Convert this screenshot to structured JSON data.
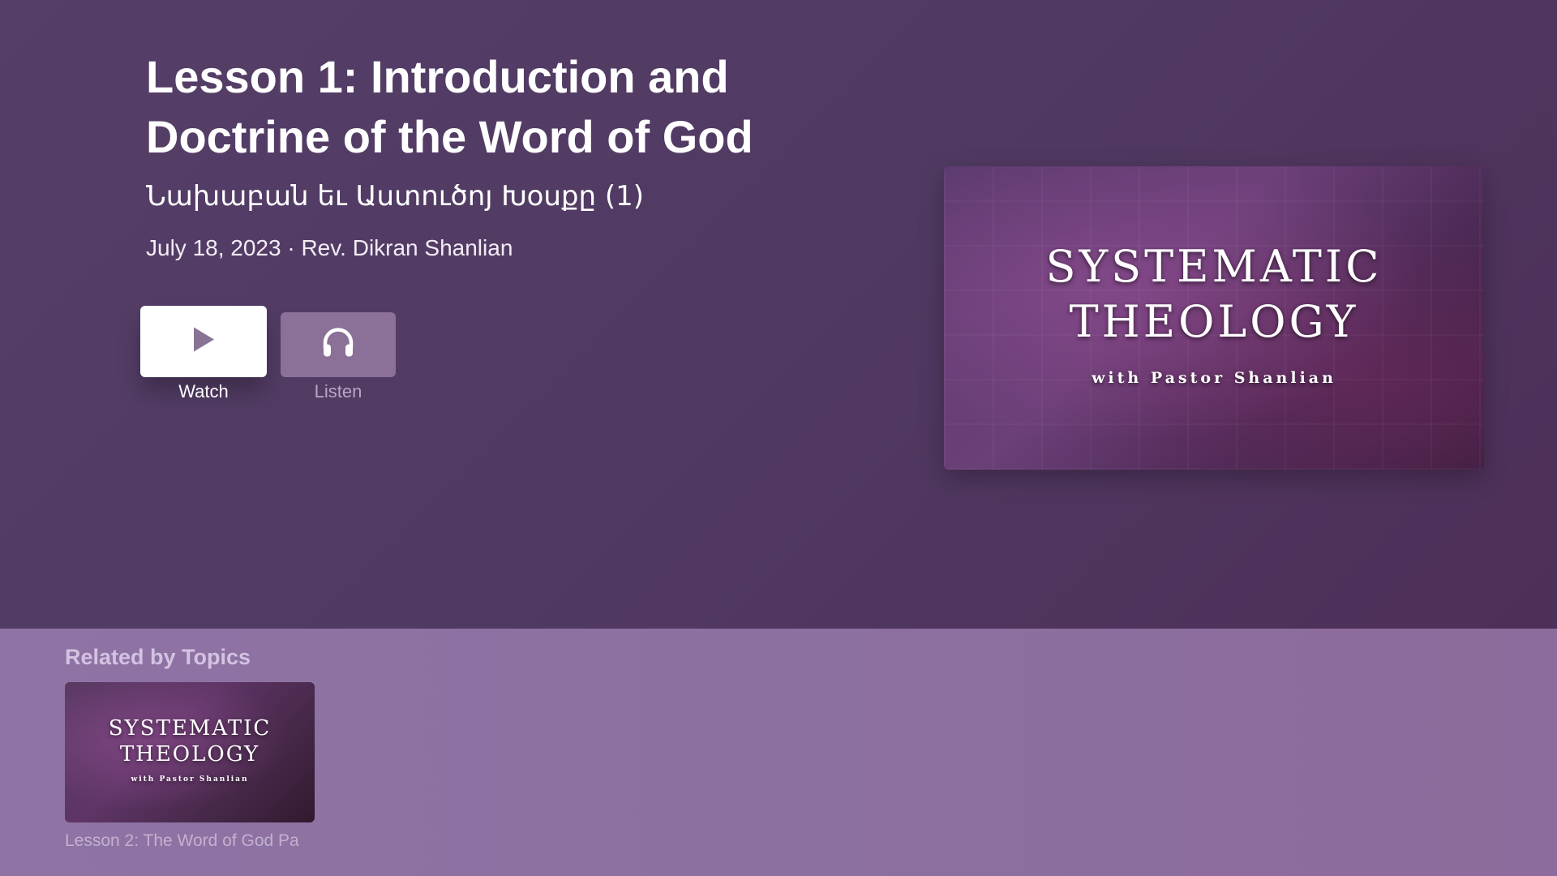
{
  "episode": {
    "title": "Lesson 1: Introduction and Doctrine of the Word of God",
    "subtitle": "Նախաբան եւ Աստուծոյ Խօսքը (1)",
    "meta": "July 18, 2023 · Rev. Dikran Shanlian"
  },
  "actions": {
    "watch": {
      "label": "Watch",
      "icon": "play-icon"
    },
    "listen": {
      "label": "Listen",
      "icon": "headphones-icon"
    }
  },
  "poster": {
    "line1": "SYSTEMATIC",
    "line2": "THEOLOGY",
    "line3": "with Pastor Shanlian"
  },
  "related": {
    "heading": "Related by Topics",
    "items": [
      {
        "thumb_line1": "SYSTEMATIC",
        "thumb_line2": "THEOLOGY",
        "thumb_line3": "with Pastor Shanlian",
        "caption": "Lesson 2: The Word of God Pa"
      }
    ]
  },
  "colors": {
    "background": "#523c64",
    "related_band": "#8e73a4",
    "watch_button": "#ffffff",
    "listen_button": "#8b7098"
  }
}
